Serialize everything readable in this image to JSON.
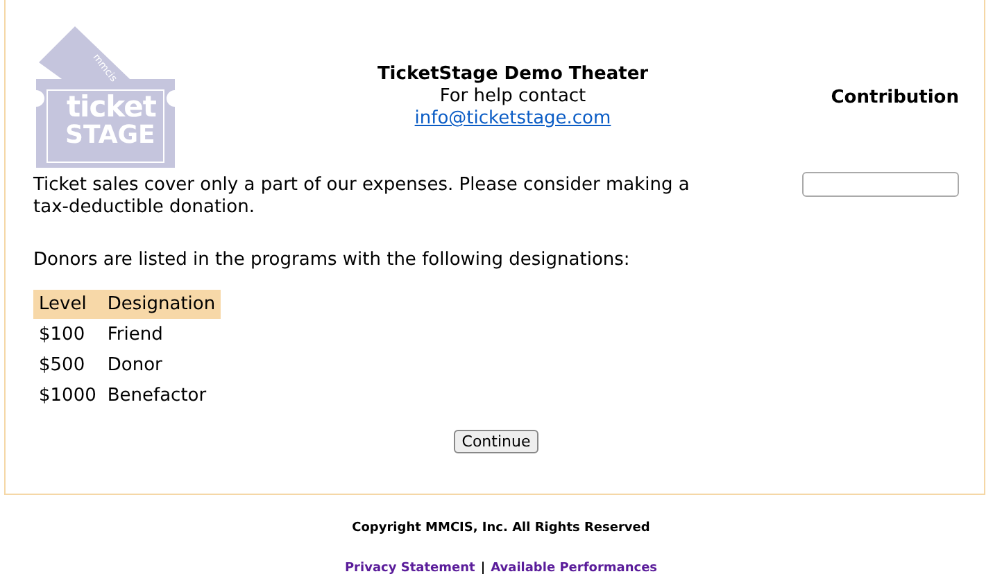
{
  "logo": {
    "small_text": "mmcis",
    "line1": "ticket",
    "line2": "STAGE"
  },
  "header": {
    "title": "TicketStage Demo Theater",
    "help": "For help contact",
    "email": "info@ticketstage.com"
  },
  "contribution": {
    "label": "Contribution"
  },
  "intro": "Ticket sales cover only a part of our expenses. Please consider making a tax-deductible donation.",
  "donors_note": "Donors are listed in the programs with the following designations:",
  "table": {
    "columns": [
      "Level",
      "Designation"
    ],
    "rows": [
      [
        "$100",
        "Friend"
      ],
      [
        "$500",
        "Donor"
      ],
      [
        "$1000",
        "Benefactor"
      ]
    ]
  },
  "continue_button": "Continue",
  "footer": {
    "copyright": "Copyright MMCIS, Inc. All Rights Reserved",
    "links": [
      "Privacy Statement",
      "Available Performances"
    ],
    "separator": "|"
  }
}
